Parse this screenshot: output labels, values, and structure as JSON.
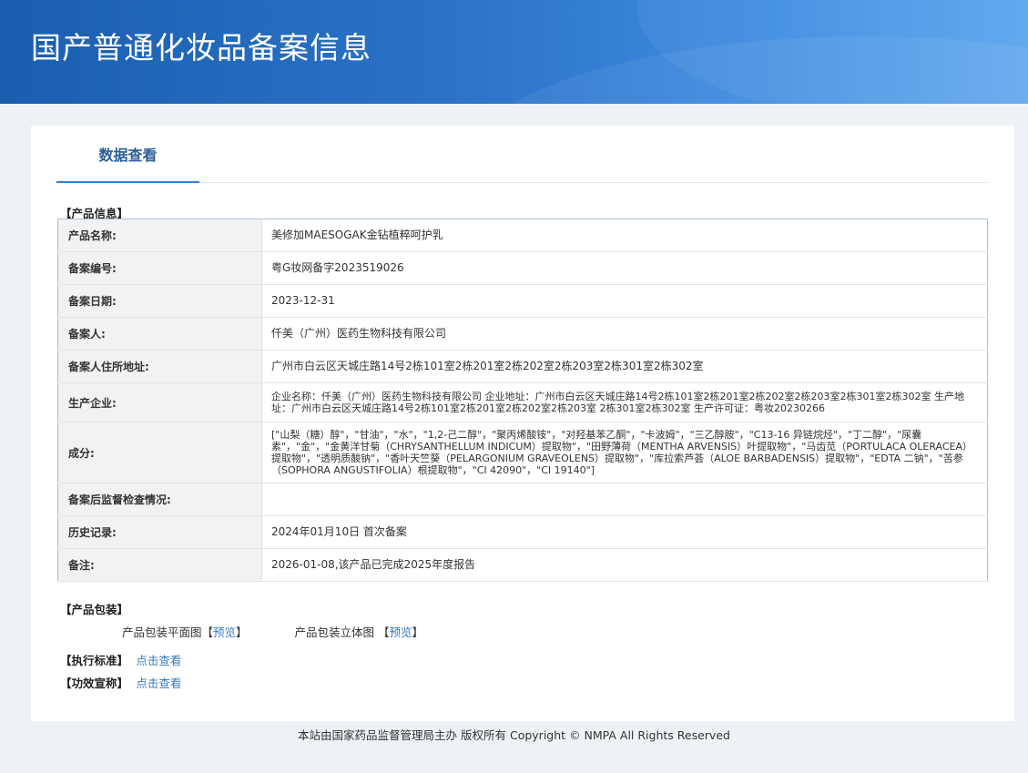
{
  "header": {
    "title": "国产普通化妆品备案信息"
  },
  "tabs": [
    {
      "label": "数据查看",
      "active": true
    }
  ],
  "sections": {
    "product_info": "【产品信息】",
    "packaging": "【产品包装】",
    "standard": "【执行标准】",
    "efficacy": "【功效宣称】"
  },
  "product_info": [
    {
      "label": "产品名称:",
      "value": "美修加MAESOGAK金钻植粹呵护乳"
    },
    {
      "label": "备案编号:",
      "value": "粤G妆网备字2023519026"
    },
    {
      "label": "备案日期:",
      "value": "2023-12-31"
    },
    {
      "label": "备案人:",
      "value": "仟美（广州）医药生物科技有限公司"
    },
    {
      "label": "备案人住所地址:",
      "value": "广州市白云区天城庄路14号2栋101室2栋201室2栋202室2栋203室2栋301室2栋302室"
    },
    {
      "label": "生产企业:",
      "value": "企业名称：仟美（广州）医药生物科技有限公司 企业地址：广州市白云区天城庄路14号2栋101室2栋201室2栋202室2栋203室2栋301室2栋302室 生产地址：广州市白云区天城庄路14号2栋101室2栋201室2栋202室2栋203室 2栋301室2栋302室 生产许可证：粤妆20230266"
    },
    {
      "label": "成分:",
      "value": "[\"山梨（糖）醇\"，\"甘油\"，\"水\"，\"1,2-己二醇\"，\"聚丙烯酸铵\"，\"对羟基苯乙酮\"，\"卡波姆\"，\"三乙醇胺\"，\"C13-16 异链烷烃\"，\"丁二醇\"，\"尿囊素\"，\"金\"，\"金黄洋甘菊（CHRYSANTHELLUM INDICUM）提取物\"，\"田野薄荷（MENTHA ARVENSIS）叶提取物\"，\"马齿苋（PORTULACA OLERACEA）提取物\"，\"透明质酸钠\"，\"香叶天竺葵（PELARGONIUM GRAVEOLENS）提取物\"，\"库拉索芦荟（ALOE BARBADENSIS）提取物\"，\"EDTA 二钠\"，\"苦参（SOPHORA ANGUSTIFOLIA）根提取物\"，\"CI 42090\"，\"CI 19140\"]"
    },
    {
      "label": "备案后监督检查情况:",
      "value": ""
    },
    {
      "label": "历史记录:",
      "value": "2024年01月10日 首次备案"
    },
    {
      "label": "备注:",
      "value": "2026-01-08,该产品已完成2025年度报告"
    }
  ],
  "packaging": {
    "flat_label": "产品包装平面图",
    "flat_link": "预览",
    "stereo_label": "产品包装立体图",
    "stereo_link": "预览"
  },
  "links": {
    "standard": "点击查看",
    "efficacy": "点击查看"
  },
  "footer": {
    "text": "本站由国家药品监督管理局主办 版权所有 Copyright © NMPA All Rights Reserved"
  },
  "colors": {
    "banner": "#2c73c9",
    "link": "#3a7bbf",
    "tab_active": "#2b5f96"
  }
}
